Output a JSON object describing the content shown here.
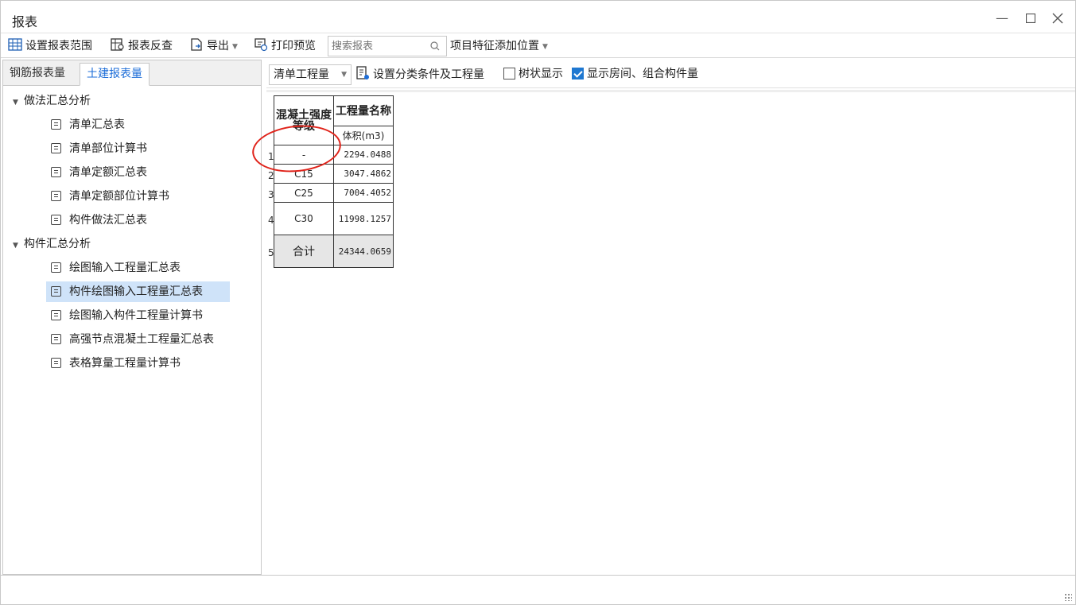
{
  "window": {
    "title": "报表"
  },
  "toolbar": {
    "set_range": "设置报表范围",
    "reverse_check": "报表反查",
    "export": "导出",
    "print_preview": "打印预览",
    "search_placeholder": "搜索报表",
    "item_feature_position": "项目特征添加位置"
  },
  "left_tabs": [
    "钢筋报表量",
    "土建报表量"
  ],
  "active_tab": "土建报表量",
  "tree": {
    "groups": [
      {
        "label": "做法汇总分析",
        "items": [
          "清单汇总表",
          "清单部位计算书",
          "清单定额汇总表",
          "清单定额部位计算书",
          "构件做法汇总表"
        ]
      },
      {
        "label": "构件汇总分析",
        "items": [
          "绘图输入工程量汇总表",
          "构件绘图输入工程量汇总表",
          "绘图输入构件工程量计算书",
          "高强节点混凝土工程量汇总表",
          "表格算量工程量计算书"
        ]
      }
    ],
    "selected": "构件绘图输入工程量汇总表"
  },
  "right_toolbar": {
    "combo_value": "清单工程量",
    "set_classification": "设置分类条件及工程量",
    "tree_display": "树状显示",
    "tree_display_checked": false,
    "show_rooms": "显示房间、组合构件量",
    "show_rooms_checked": true
  },
  "report_table": {
    "col1_header": "混凝土强度等级",
    "col2_header": "工程量名称",
    "unit_header": "体积(m3)",
    "rows": [
      {
        "num": "1",
        "grade": "-",
        "volume": "2294.0488"
      },
      {
        "num": "2",
        "grade": "C15",
        "volume": "3047.4862"
      },
      {
        "num": "3",
        "grade": "C25",
        "volume": "7004.4052"
      },
      {
        "num": "4",
        "grade": "C30",
        "volume": "11998.1257"
      }
    ],
    "total": {
      "num": "5",
      "label": "合计",
      "volume": "24344.0659"
    }
  },
  "colors": {
    "accent": "#1e6ed8",
    "selected_bg": "#cfe3f9",
    "annotation": "#e0231a",
    "checkbox": "#1f78d1"
  }
}
